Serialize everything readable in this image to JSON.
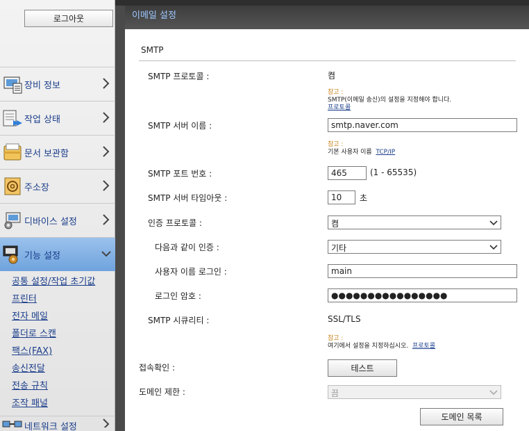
{
  "sidebar": {
    "logout_label": "로그아웃",
    "nav": [
      {
        "label": "장비 정보",
        "icon": "device-info-icon"
      },
      {
        "label": "작업 상태",
        "icon": "job-status-icon"
      },
      {
        "label": "문서 보관함",
        "icon": "document-box-icon"
      },
      {
        "label": "주소장",
        "icon": "address-book-icon"
      },
      {
        "label": "디바이스 설정",
        "icon": "device-settings-icon"
      },
      {
        "label": "기능 설정",
        "icon": "function-settings-icon"
      },
      {
        "label": "네트워크 설정",
        "icon": "network-settings-icon"
      }
    ],
    "subnav": [
      "공통 설정/작업 초기값",
      "프린터",
      "전자 메일",
      "폴더로 스캔",
      "팩스(FAX)",
      "송신전달",
      "전송 규칙",
      "조작 패널"
    ]
  },
  "panel": {
    "title": "이메일 설정",
    "section": "SMTP"
  },
  "form": {
    "protocol_label": "SMTP 프로토콜 :",
    "protocol_value": "켬",
    "note1_warn": "참고 :",
    "note1_text": "SMTP(이메일 송신)의 설정을 지정해야 합니다.",
    "note1_link": "프로토콜",
    "server_label": "SMTP 서버 이름 :",
    "server_value": "smtp.naver.com",
    "note2_warn": "참고 :",
    "note2_text": "기본 사용자 이름",
    "note2_link": "TCP/IP",
    "port_label": "SMTP 포트 번호 :",
    "port_value": "465",
    "port_range": "(1 - 65535)",
    "timeout_label": "SMTP 서버 타임아웃 :",
    "timeout_value": "10",
    "timeout_unit": "초",
    "auth_label": "인증 프로토콜 :",
    "auth_value": "켬",
    "auth_as_label": "다음과 같이 인증 :",
    "auth_as_value": "기타",
    "username_label": "사용자 이름 로그인 :",
    "username_value": "main",
    "password_label": "로그인 암호 :",
    "password_value": "●●●●●●●●●●●●●●●●",
    "security_label": "SMTP 시큐리티 :",
    "security_value": "SSL/TLS",
    "note3_warn": "참고 :",
    "note3_text": "여기에서 설정을 지정하십시오.",
    "note3_link": "프로토콜",
    "connect_label": "접속확인 :",
    "test_button": "테스트",
    "domain_label": "도메인 제한 :",
    "domain_value": "끔",
    "domain_list_button": "도메인 목록"
  },
  "colors": {
    "accent": "#6fa3dd",
    "link": "#1a3d8a",
    "warn": "#c8831b",
    "header_text": "#9cc6ff"
  }
}
